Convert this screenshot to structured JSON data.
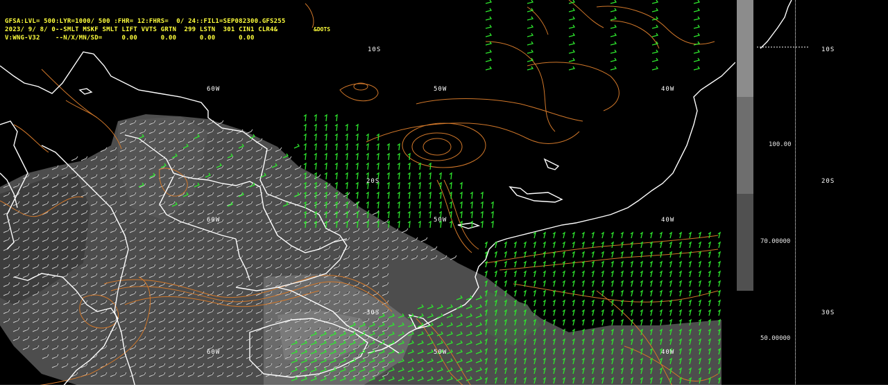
{
  "header": {
    "line1": "GFSA:LVL= 500:LYR=1000/ 500 :FHR= 12:FHRS=  0/ 24::FIL1=SEP082300.GFS255",
    "line2": "2023/ 9/ 8/ 0--SMLT MSKF SMLT LIFT VVTS GRTN  299 LSTN  301 CIN1 CLR4&",
    "line3": "V:WNG-V32    --N/X/MN/SD=     0.00      0.00      0.00      0.00",
    "dots_tag": "&DOTS"
  },
  "grid_labels": {
    "lat_10s": "10S",
    "lat_20s": "20S",
    "lat_30s": "30S",
    "lon_60w": "60W",
    "lon_50w": "50W",
    "lon_40w": "40W"
  },
  "colorbar": {
    "segments": [
      "#8c8c8c",
      "#6e6e6e",
      "#505050",
      "#383838"
    ],
    "labels": [
      "100.00",
      "70.00000",
      "50.00000"
    ]
  },
  "colors": {
    "background": "#000000",
    "coastline": "#ffffff",
    "contour": "#d2782a",
    "wind_barb": "#2ee82e",
    "shaded_area": "#5a5a5a",
    "header_text": "#ffff3c"
  }
}
